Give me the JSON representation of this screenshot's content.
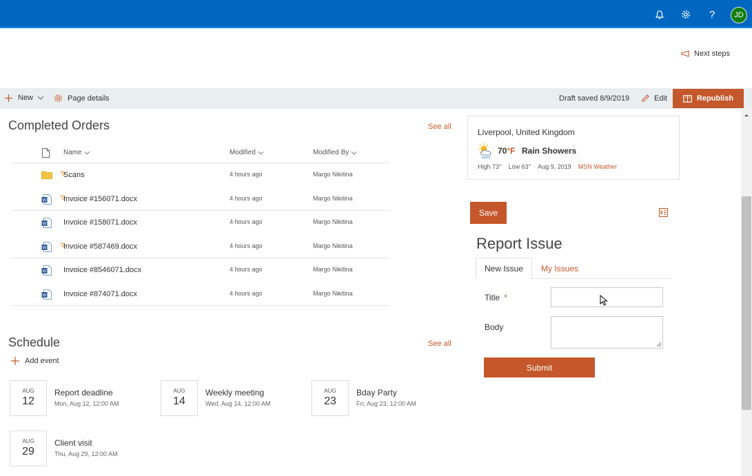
{
  "suitebar": {
    "accent": "#0067c0",
    "icons": [
      "bell-icon",
      "gear-icon",
      "help-icon"
    ],
    "help_glyph": "?",
    "user_initials": "JD"
  },
  "header": {
    "next_steps": "Next steps"
  },
  "command_bar": {
    "new_label": "New",
    "page_details_label": "Page details",
    "draft_status": "Draft saved 8/9/2019",
    "edit_label": "Edit",
    "republish_label": "Republish",
    "accent": "#c4572b"
  },
  "orders": {
    "title": "Completed Orders",
    "see_all": "See all",
    "columns": {
      "name": "Name",
      "modified": "Modified",
      "modified_by": "Modified By"
    },
    "rows": [
      {
        "name": "Scans",
        "modified": "4 hours ago",
        "modified_by": "Margo Nikitina",
        "type": "folder",
        "new": true
      },
      {
        "name": "Invoice #156071.docx",
        "modified": "4 hours ago",
        "modified_by": "Margo Nikitina",
        "type": "word",
        "new": true
      },
      {
        "name": "Invoice #158071.docx",
        "modified": "4 hours ago",
        "modified_by": "Margo Nikitina",
        "type": "word",
        "new": false
      },
      {
        "name": "Invoice #587469.docx",
        "modified": "4 hours ago",
        "modified_by": "Margo Nikitina",
        "type": "word",
        "new": true
      },
      {
        "name": "Invoice #8546071.docx",
        "modified": "4 hours ago",
        "modified_by": "Margo Nikitina",
        "type": "word",
        "new": false
      },
      {
        "name": "Invoice #874071.docx",
        "modified": "4 hours ago",
        "modified_by": "Margo Nikitina",
        "type": "word",
        "new": false
      }
    ]
  },
  "schedule": {
    "title": "Schedule",
    "see_all": "See all",
    "add_event": "Add event",
    "events": [
      {
        "month": "AUG",
        "day": "12",
        "title": "Report deadline",
        "time": "Mon, Aug 12, 12:00 AM"
      },
      {
        "month": "AUG",
        "day": "14",
        "title": "Weekly meeting",
        "time": "Wed, Aug 14, 12:00 AM"
      },
      {
        "month": "AUG",
        "day": "23",
        "title": "Bday Party",
        "time": "Fri, Aug 23, 12:00 AM"
      },
      {
        "month": "AUG",
        "day": "29",
        "title": "Client visit",
        "time": "Thu, Aug 29, 12:00 AM"
      }
    ]
  },
  "weather": {
    "location": "Liverpool, United Kingdom",
    "temp": "70",
    "unit": "°F",
    "condition": "Rain Showers",
    "high": "High 73°",
    "low": "Low 63°",
    "date": "Aug 9, 2019",
    "source": "MSN Weather",
    "icon": "sun-rain-cloud-icon"
  },
  "report": {
    "save_label": "Save",
    "title": "Report Issue",
    "tabs": [
      "New Issue",
      "My Issues"
    ],
    "title_label": "Title",
    "required_mark": "*",
    "body_label": "Body",
    "title_value": "",
    "body_value": "",
    "submit_label": "Submit",
    "export_icon": "excel-export-icon"
  }
}
